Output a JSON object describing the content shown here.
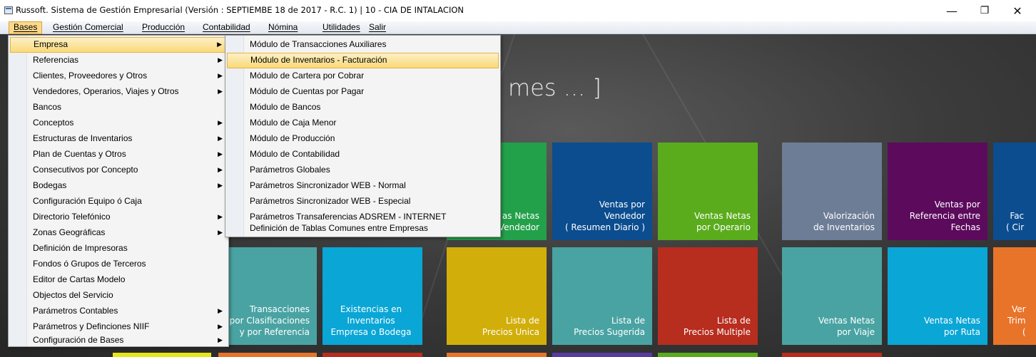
{
  "window": {
    "title": "Russoft. Sistema de Gestión Empresarial (Versión : SEPTIEMBE 18 de 2017 - R.C. 1) | 10 - CIA DE INTALACION",
    "minimize": "—",
    "maximize": "❐",
    "close": "✕"
  },
  "menubar": [
    "Bases",
    "Gestión Comercial",
    "Producción",
    "Contabilidad",
    "Nómina",
    "Utilidades",
    "Salir"
  ],
  "dashboard": {
    "title": "mes ... ]",
    "tiles": [
      {
        "text": "as Netas\nVendedor",
        "color": "#23a04a"
      },
      {
        "text": "Ventas por\nVendedor\n( Resumen Diario )",
        "color": "#0b4d8f"
      },
      {
        "text": "Ventas Netas\npor Operario",
        "color": "#5aac1c"
      },
      {
        "text": "Valorización\nde Inventarios",
        "color": "#6e7d96"
      },
      {
        "text": "Ventas por\nReferencia entre\nFechas",
        "color": "#5c0a5c"
      },
      {
        "text": "Fac\n( Cir",
        "color": "#0b4d8f"
      },
      {
        "text": "Transacciones\npor Clasificaciones\ny por Referencia",
        "color": "#4aa3a3"
      },
      {
        "text": "Existencias en\nInventarios\nEmpresa o Bodega",
        "color": "#0aa6d6"
      },
      {
        "text": "Lista de\nPrecios Unica",
        "color": "#d2ae0a"
      },
      {
        "text": "Lista de\nPrecios Sugerida",
        "color": "#4aa3a3"
      },
      {
        "text": "Lista de\nPrecios Multiple",
        "color": "#b72d1e"
      },
      {
        "text": "Ventas Netas\npor Viaje",
        "color": "#4aa3a3"
      },
      {
        "text": "Ventas Netas\npor Ruta",
        "color": "#0aa6d6"
      },
      {
        "text": "Ver\nTrim\n(",
        "color": "#e8742a"
      }
    ]
  },
  "bases_menu": [
    {
      "label": "Empresa",
      "submenu": true
    },
    {
      "label": "Referencias",
      "submenu": true
    },
    {
      "label": "Clientes, Proveedores y Otros",
      "submenu": true
    },
    {
      "label": "Vendedores, Operarios, Viajes y Otros",
      "submenu": true
    },
    {
      "label": "Bancos",
      "submenu": false
    },
    {
      "label": "Conceptos",
      "submenu": true
    },
    {
      "label": "Estructuras de Inventarios",
      "submenu": true
    },
    {
      "label": "Plan de Cuentas y Otros",
      "submenu": true
    },
    {
      "label": "Consecutivos por Concepto",
      "submenu": true
    },
    {
      "label": "Bodegas",
      "submenu": true
    },
    {
      "label": "Configuración  Equipo ó Caja",
      "submenu": false
    },
    {
      "label": "Directorio Telefónico",
      "submenu": true
    },
    {
      "label": "Zonas Geográficas",
      "submenu": true
    },
    {
      "label": "Definición de Impresoras",
      "submenu": false
    },
    {
      "label": "Fondos ó Grupos de Terceros",
      "submenu": false
    },
    {
      "label": "Editor de Cartas Modelo",
      "submenu": false
    },
    {
      "label": "Objectos del Servicio",
      "submenu": false
    },
    {
      "label": "Parámetros Contables",
      "submenu": true
    },
    {
      "label": "Parámetros y Definciones NIIF",
      "submenu": true
    },
    {
      "label": "Configuración de Bases",
      "submenu": true
    }
  ],
  "empresa_submenu": [
    "Módulo de Transacciones Auxiliares",
    "Módulo de Inventarios - Facturación",
    "Módulo de Cartera por Cobrar",
    "Módulo de Cuentas por Pagar",
    "Módulo de Bancos",
    "Módulo de Caja Menor",
    "Módulo de Producción",
    "Módulo de Contabilidad",
    "Parámetros Globales",
    "Parámetros Sincronizador WEB - Normal",
    "Parámetros Sincronizador WEB - Especial",
    "Parámetros Transaferencias ADSREM - INTERNET",
    "Definición de Tablas Comunes entre Empresas"
  ],
  "colors": {
    "highlight": "#f9d978",
    "menu_bg": "#f4f4f4",
    "dashboard_bg": "#3c3c3c"
  }
}
